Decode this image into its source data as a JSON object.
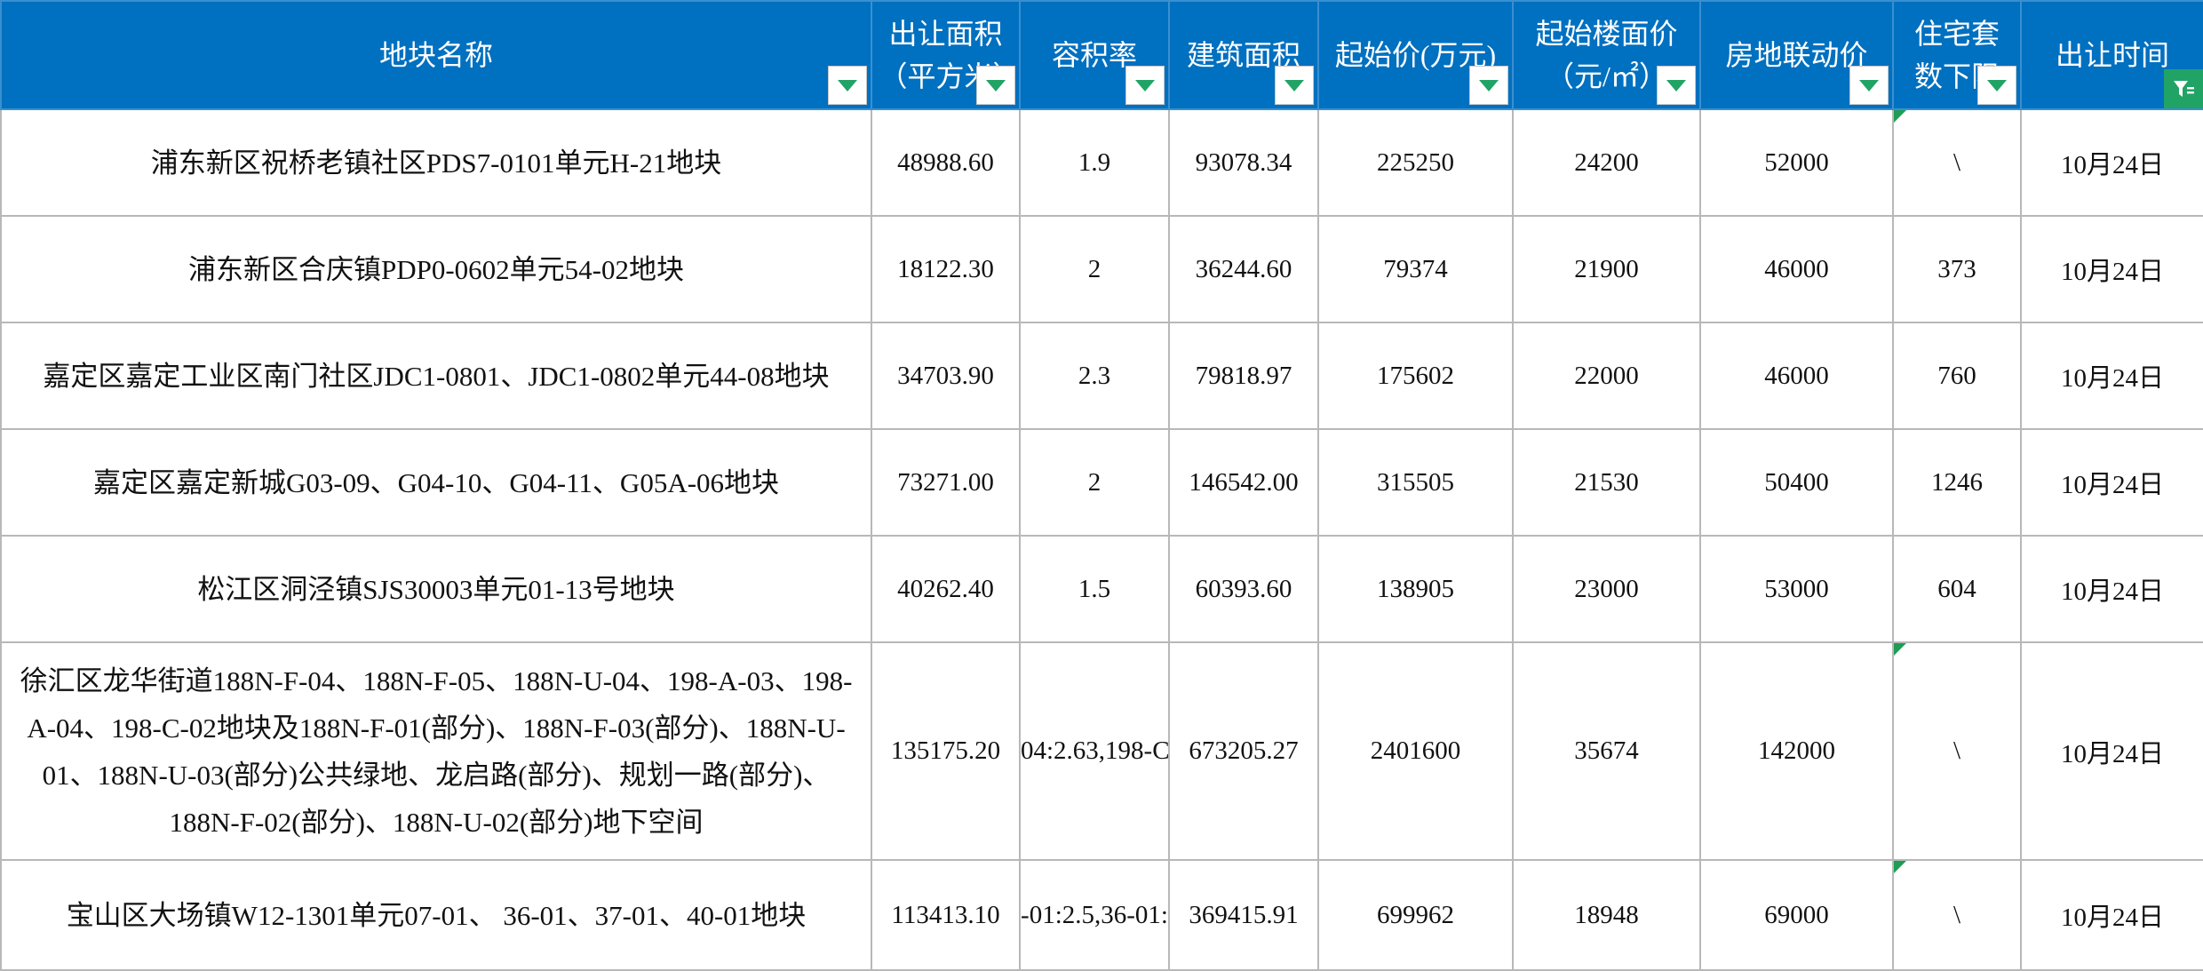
{
  "columns": [
    {
      "label": "地块名称",
      "width": 980,
      "filter": "dropdown"
    },
    {
      "label": "出让面积（平方米）",
      "width": 167,
      "filter": "dropdown"
    },
    {
      "label": "容积率",
      "width": 168,
      "filter": "dropdown"
    },
    {
      "label": "建筑面积",
      "width": 168,
      "filter": "dropdown"
    },
    {
      "label": "起始价(万元)",
      "width": 219,
      "filter": "dropdown"
    },
    {
      "label": "起始楼面价（元/㎡）",
      "width": 211,
      "filter": "dropdown"
    },
    {
      "label": "房地联动价",
      "width": 217,
      "filter": "dropdown"
    },
    {
      "label": "住宅套数下限",
      "width": 144,
      "filter": "dropdown"
    },
    {
      "label": "出让时间",
      "width": 206,
      "filter": "active"
    }
  ],
  "rows": [
    {
      "name": "浦东新区祝桥老镇社区PDS7-0101单元H-21地块",
      "area": "48988.60",
      "far": "1.9",
      "gfa": "93078.34",
      "price": "225250",
      "floor_price": "24200",
      "linked_price": "52000",
      "units": "\\",
      "date": "10月24日",
      "units_comment": true
    },
    {
      "name": "浦东新区合庆镇PDP0-0602单元54-02地块",
      "area": "18122.30",
      "far": "2",
      "gfa": "36244.60",
      "price": "79374",
      "floor_price": "21900",
      "linked_price": "46000",
      "units": "373",
      "date": "10月24日",
      "units_comment": false
    },
    {
      "name": "嘉定区嘉定工业区南门社区JDC1-0801、JDC1-0802单元44-08地块",
      "area": "34703.90",
      "far": "2.3",
      "gfa": "79818.97",
      "price": "175602",
      "floor_price": "22000",
      "linked_price": "46000",
      "units": "760",
      "date": "10月24日",
      "units_comment": false
    },
    {
      "name": "嘉定区嘉定新城G03-09、G04-10、G04-11、G05A-06地块",
      "area": "73271.00",
      "far": "2",
      "gfa": "146542.00",
      "price": "315505",
      "floor_price": "21530",
      "linked_price": "50400",
      "units": "1246",
      "date": "10月24日",
      "units_comment": false
    },
    {
      "name": "松江区洞泾镇SJS30003单元01-13号地块",
      "area": "40262.40",
      "far": "1.5",
      "gfa": "60393.60",
      "price": "138905",
      "floor_price": "23000",
      "linked_price": "53000",
      "units": "604",
      "date": "10月24日",
      "units_comment": false
    },
    {
      "name": "徐汇区龙华街道188N-F-04、188N-F-05、188N-U-04、198-A-03、198-A-04、198-C-02地块及188N-F-01(部分)、188N-F-03(部分)、188N-U-01、188N-U-03(部分)公共绿地、龙启路(部分)、规划一路(部分)、188N-F-02(部分)、188N-U-02(部分)地下空间",
      "area": "135175.20",
      "far": "04:2.63,198-C",
      "gfa": "673205.27",
      "price": "2401600",
      "floor_price": "35674",
      "linked_price": "142000",
      "units": "\\",
      "date": "10月24日",
      "units_comment": true
    },
    {
      "name": "宝山区大场镇W12-1301单元07-01、 36-01、37-01、40-01地块",
      "area": "113413.10",
      "far": "-01:2.5,36-01:",
      "gfa": "369415.91",
      "price": "699962",
      "floor_price": "18948",
      "linked_price": "69000",
      "units": "\\",
      "date": "10月24日",
      "units_comment": true
    }
  ]
}
